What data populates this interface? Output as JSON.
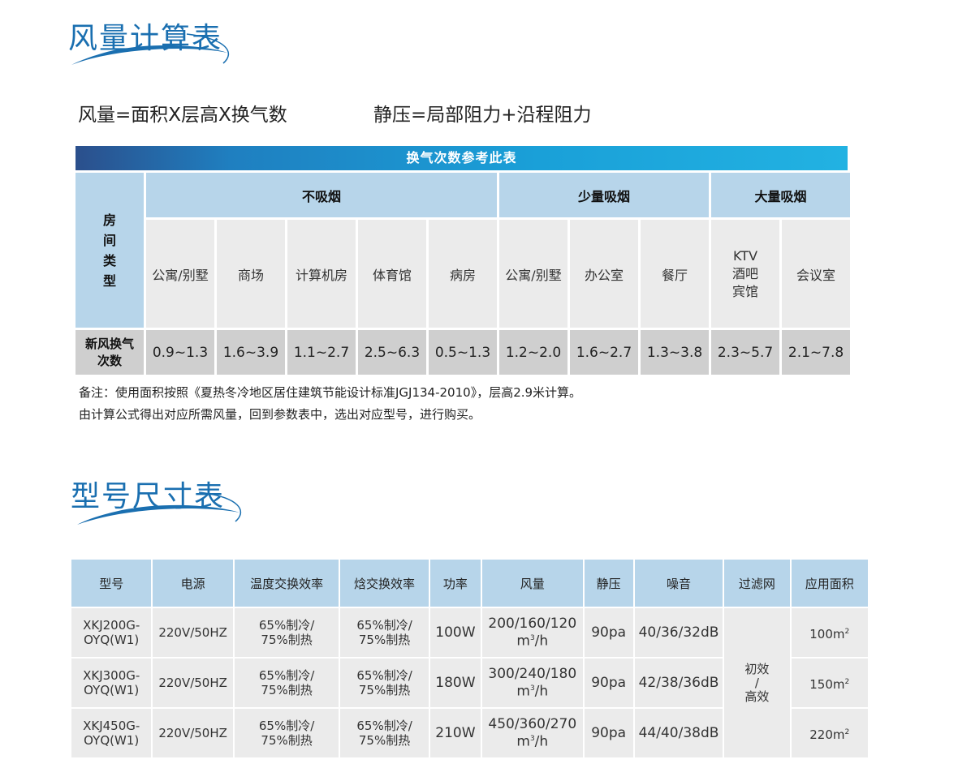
{
  "section1": {
    "title": "风量计算表"
  },
  "formulas": {
    "left": "风量=面积X层高X换气数",
    "right": "静压=局部阻力+沿程阻力"
  },
  "air_table": {
    "banner": "换气次数参考此表",
    "row_header": [
      "房",
      "间",
      "类",
      "型"
    ],
    "groups": [
      "不吸烟",
      "少量吸烟",
      "大量吸烟"
    ],
    "rooms": [
      "公寓/别墅",
      "商场",
      "计算机房",
      "体育馆",
      "病房",
      "公寓/别墅",
      "办公室",
      "餐厅"
    ],
    "ktv": [
      "KTV",
      "酒吧",
      "宾馆"
    ],
    "meeting": "会议室",
    "value_label": [
      "新风换气",
      "次数"
    ],
    "values": [
      "0.9~1.3",
      "1.6~3.9",
      "1.1~2.7",
      "2.5~6.3",
      "0.5~1.3",
      "1.2~2.0",
      "1.6~2.7",
      "1.3~3.8",
      "2.3~5.7",
      "2.1~7.8"
    ]
  },
  "notes": [
    "备注：使用面积按照《夏热冬冷地区居住建筑节能设计标准JGJ134-2010》，层高2.9米计算。",
    "由计算公式得出对应所需风量，回到参数表中，选出对应型号，进行购买。"
  ],
  "section2": {
    "title": "型号尺寸表"
  },
  "model_table": {
    "headers": [
      "型号",
      "电源",
      "温度交换效率",
      "焓交换效率",
      "功率",
      "风量",
      "静压",
      "噪音",
      "过滤网",
      "应用面积"
    ],
    "filter": [
      "初效",
      "/",
      "高效"
    ],
    "area_unit": "m",
    "area_sup": "2",
    "flow_unit": "m",
    "flow_sup": "3",
    "flow_suffix": "/h",
    "rows": [
      {
        "model": [
          "XKJ200G-",
          "OYQ(W1)"
        ],
        "power_supply": "220V/50HZ",
        "temp_eff": [
          "65%制冷/",
          "75%制热"
        ],
        "enth_eff": [
          "65%制冷/",
          "75%制热"
        ],
        "power": "100W",
        "flow": "200/160/120",
        "pressure": "90pa",
        "noise": "40/36/32dB",
        "area": "100"
      },
      {
        "model": [
          "XKJ300G-",
          "OYQ(W1)"
        ],
        "power_supply": "220V/50HZ",
        "temp_eff": [
          "65%制冷/",
          "75%制热"
        ],
        "enth_eff": [
          "65%制冷/",
          "75%制热"
        ],
        "power": "180W",
        "flow": "300/240/180",
        "pressure": "90pa",
        "noise": "42/38/36dB",
        "area": "150"
      },
      {
        "model": [
          "XKJ450G-",
          "OYQ(W1)"
        ],
        "power_supply": "220V/50HZ",
        "temp_eff": [
          "65%制冷/",
          "75%制热"
        ],
        "enth_eff": [
          "65%制冷/",
          "75%制热"
        ],
        "power": "210W",
        "flow": "450/360/270",
        "pressure": "90pa",
        "noise": "44/40/38dB",
        "area": "220"
      }
    ]
  }
}
